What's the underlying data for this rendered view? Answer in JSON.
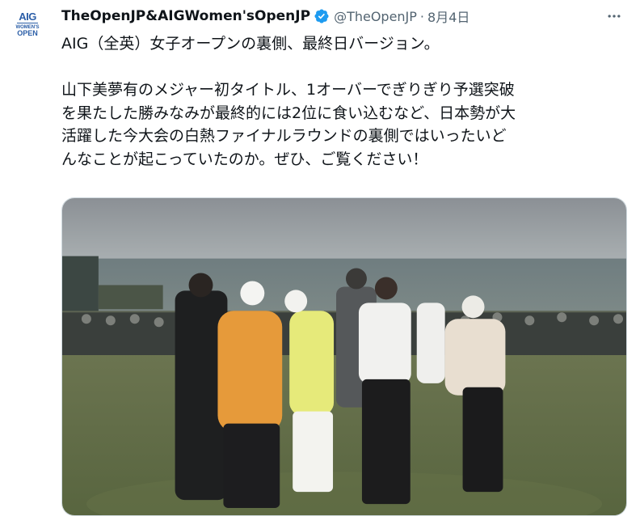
{
  "account": {
    "avatar_logo_line1": "AIG",
    "avatar_logo_line2": "WOMEN'S",
    "avatar_logo_line3": "OPEN",
    "display_name": "TheOpenJP&AIGWomen'sOpenJP",
    "handle": "@TheOpenJP",
    "separator": "·",
    "date": "8月4日"
  },
  "tweet": {
    "line1": "AIG（全英）女子オープンの裏側、最終日バージョン。",
    "paragraph2_line1": "山下美夢有のメジャー初タイトル、1オーバーでぎりぎり予選突破",
    "paragraph2_line2": "を果たした勝みなみが最終的には2位に食い込むなど、日本勢が大",
    "paragraph2_line3": "活躍した今大会の白熱ファイナルラウンドの裏側ではいったいど",
    "paragraph2_line4": "んなことが起こっていたのか。ぜひ、ご覧ください！"
  },
  "icons": {
    "verified": "verified-badge-icon",
    "more": "more-options-icon"
  },
  "colors": {
    "verified_blue": "#1d9bf0",
    "secondary_text": "#536471",
    "brand_blue": "#2b5ea7"
  }
}
